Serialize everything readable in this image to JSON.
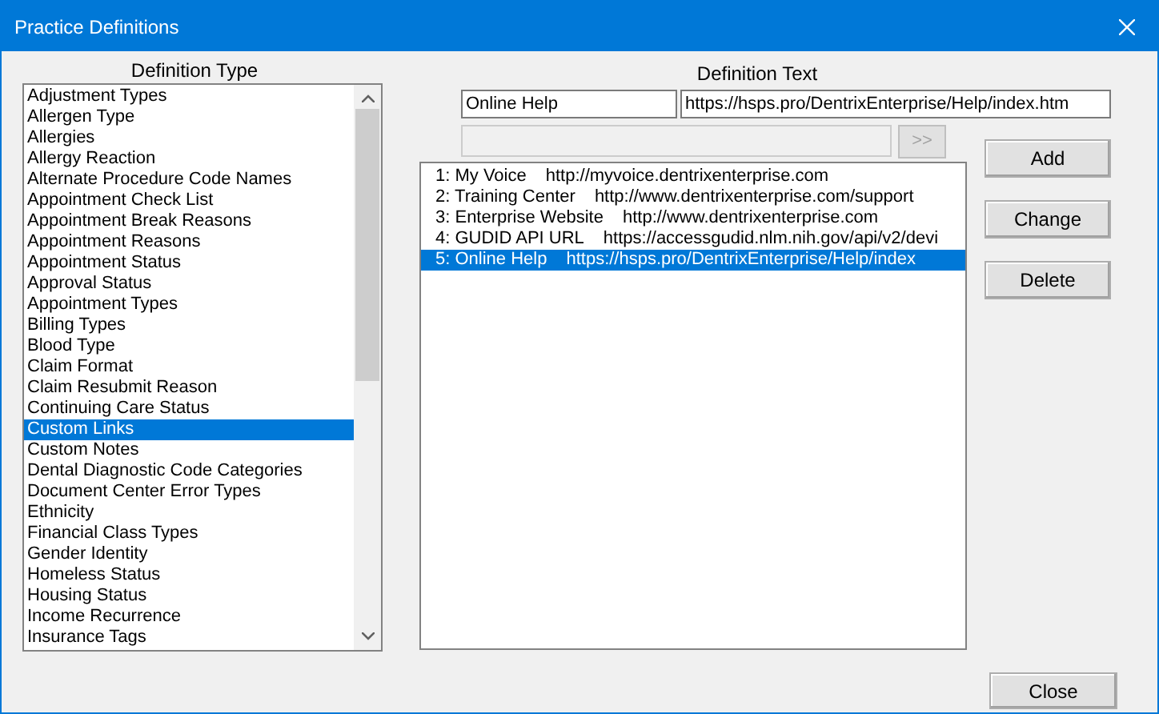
{
  "window": {
    "title": "Practice Definitions"
  },
  "definition_type": {
    "label": "Definition Type",
    "items": [
      {
        "label": "Adjustment Types",
        "selected": false
      },
      {
        "label": "Allergen Type",
        "selected": false
      },
      {
        "label": "Allergies",
        "selected": false
      },
      {
        "label": "Allergy Reaction",
        "selected": false
      },
      {
        "label": "Alternate Procedure Code Names",
        "selected": false
      },
      {
        "label": "Appointment Check List",
        "selected": false
      },
      {
        "label": "Appointment Break Reasons",
        "selected": false
      },
      {
        "label": "Appointment Reasons",
        "selected": false
      },
      {
        "label": "Appointment Status",
        "selected": false
      },
      {
        "label": "Approval Status",
        "selected": false
      },
      {
        "label": "Appointment Types",
        "selected": false
      },
      {
        "label": "Billing Types",
        "selected": false
      },
      {
        "label": "Blood Type",
        "selected": false
      },
      {
        "label": "Claim Format",
        "selected": false
      },
      {
        "label": "Claim Resubmit Reason",
        "selected": false
      },
      {
        "label": "Continuing Care Status",
        "selected": false
      },
      {
        "label": "Custom Links",
        "selected": true
      },
      {
        "label": "Custom Notes",
        "selected": false
      },
      {
        "label": "Dental Diagnostic Code Categories",
        "selected": false
      },
      {
        "label": "Document Center Error Types",
        "selected": false
      },
      {
        "label": "Ethnicity",
        "selected": false
      },
      {
        "label": "Financial Class Types",
        "selected": false
      },
      {
        "label": "Gender Identity",
        "selected": false
      },
      {
        "label": "Homeless Status",
        "selected": false
      },
      {
        "label": "Housing Status",
        "selected": false
      },
      {
        "label": "Income Recurrence",
        "selected": false
      },
      {
        "label": "Insurance Tags",
        "selected": false
      }
    ]
  },
  "definition_text": {
    "label": "Definition Text",
    "name_value": "Online Help",
    "url_value": "https://hsps.pro/DentrixEnterprise/Help/index.htm",
    "arrow_button": ">>",
    "items": [
      {
        "label": "1: My Voice",
        "url": "http://myvoice.dentrixenterprise.com",
        "selected": false
      },
      {
        "label": "2: Training Center",
        "url": "http://www.dentrixenterprise.com/support",
        "selected": false
      },
      {
        "label": "3: Enterprise Website",
        "url": "http://www.dentrixenterprise.com",
        "selected": false
      },
      {
        "label": "4: GUDID API URL",
        "url": "https://accessgudid.nlm.nih.gov/api/v2/devi",
        "selected": false
      },
      {
        "label": "5: Online Help",
        "url": "https://hsps.pro/DentrixEnterprise/Help/index",
        "selected": true
      }
    ]
  },
  "buttons": [
    "Add",
    "Change",
    "Delete"
  ],
  "close_button": "Close"
}
